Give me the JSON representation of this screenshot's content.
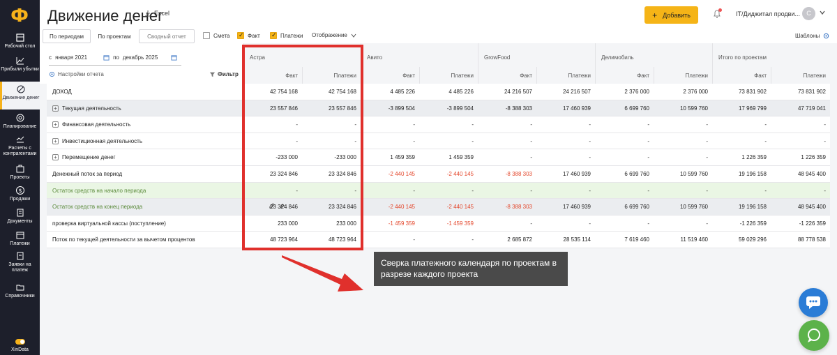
{
  "app": {
    "logo": "Ф",
    "title": "Движение денег",
    "excel_label": "Excel",
    "add_label": "Добавить",
    "company": "IT/Диджитал продви...",
    "avatar_letter": "C",
    "brand_color": "#f5b417"
  },
  "sidebar": {
    "items": [
      {
        "label": "Рабочий стол",
        "icon": "desktop-icon"
      },
      {
        "label": "Прибыли убытки",
        "icon": "chart-icon"
      },
      {
        "label": "Движение денег",
        "icon": "money-flow-icon"
      },
      {
        "label": "Планирование",
        "icon": "target-icon"
      },
      {
        "label": "Расчеты с контрагентами",
        "icon": "contractors-icon"
      },
      {
        "label": "Проекты",
        "icon": "briefcase-icon"
      },
      {
        "label": "Продажи",
        "icon": "dollar-icon"
      },
      {
        "label": "Документы",
        "icon": "documents-icon"
      },
      {
        "label": "Платежи",
        "icon": "payments-icon"
      },
      {
        "label": "Заявки на платеж",
        "icon": "request-icon"
      },
      {
        "label": "Справочники",
        "icon": "folder-icon"
      }
    ],
    "footer": "XinData"
  },
  "toolbar": {
    "by_periods": "По периодам",
    "by_projects": "По проектам",
    "summary_report": "Сводный отчет",
    "estimate": "Смета",
    "fact": "Факт",
    "payments": "Платежи",
    "display": "Отображение",
    "templates": "Шаблоны"
  },
  "filters": {
    "from_label": "с",
    "from_value": "января 2021",
    "to_label": "по",
    "to_value": "декабрь 2025",
    "settings": "Настройки отчета",
    "filter": "Фильтр"
  },
  "projects": [
    "Астра",
    "Авито",
    "GrowFood",
    "Делимобиль",
    "Итого по проектам"
  ],
  "subcols": [
    "Факт",
    "Платежи"
  ],
  "rows": [
    {
      "label": "ДОХОД",
      "values": [
        "42 754 168",
        "42 754 168",
        "4 485 226",
        "4 485 226",
        "24 216 507",
        "24 216 507",
        "2 376 000",
        "2 376 000",
        "73 831 902",
        "73 831 902"
      ]
    },
    {
      "label": "Текущая деятельность",
      "values": [
        "23 557 846",
        "23 557 846",
        "-3 899 504",
        "-3 899 504",
        "-8 388 303",
        "17 460 939",
        "6 699 760",
        "10 599 760",
        "17 969 799",
        "47 719 041"
      ]
    },
    {
      "label": "Финансовая деятельность",
      "values": [
        "-",
        "-",
        "-",
        "-",
        "-",
        "-",
        "-",
        "-",
        "-",
        "-"
      ]
    },
    {
      "label": "Инвестиционная деятельность",
      "values": [
        "-",
        "-",
        "-",
        "-",
        "-",
        "-",
        "-",
        "-",
        "-",
        "-"
      ]
    },
    {
      "label": "Перемещение денег",
      "values": [
        "-233 000",
        "-233 000",
        "1 459 359",
        "1 459 359",
        "-",
        "-",
        "-",
        "-",
        "1 226 359",
        "1 226 359"
      ]
    },
    {
      "label": "Денежный поток за период",
      "values": [
        "23 324 846",
        "23 324 846",
        "-2 440 145",
        "-2 440 145",
        "-8 388 303",
        "17 460 939",
        "6 699 760",
        "10 599 760",
        "19 196 158",
        "48 945 400"
      ]
    },
    {
      "label": "Остаток средств на начало периода",
      "values": [
        "-",
        "-",
        "-",
        "-",
        "-",
        "-",
        "-",
        "-",
        "-",
        "-"
      ]
    },
    {
      "label": "Остаток средств на конец периода",
      "values": [
        "23 324 846",
        "23 324 846",
        "-2 440 145",
        "-2 440 145",
        "-8 388 303",
        "17 460 939",
        "6 699 760",
        "10 599 760",
        "19 196 158",
        "48 945 400"
      ]
    },
    {
      "label": "проверка виртуальной кассы (поступление)",
      "values": [
        "233 000",
        "233 000",
        "-1 459 359",
        "-1 459 359",
        "-",
        "-",
        "-",
        "-",
        "-1 226 359",
        "-1 226 359"
      ]
    },
    {
      "label": "Поток по текущей деятельности за вычетом процентов",
      "values": [
        "48 723 964",
        "48 723 964",
        "-",
        "-",
        "2 685 872",
        "28 535 114",
        "7 619 460",
        "11 519 460",
        "59 029 296",
        "88 778 538"
      ]
    }
  ],
  "callout": "Сверка платежного календаря по проектам в разрезе каждого проекта"
}
